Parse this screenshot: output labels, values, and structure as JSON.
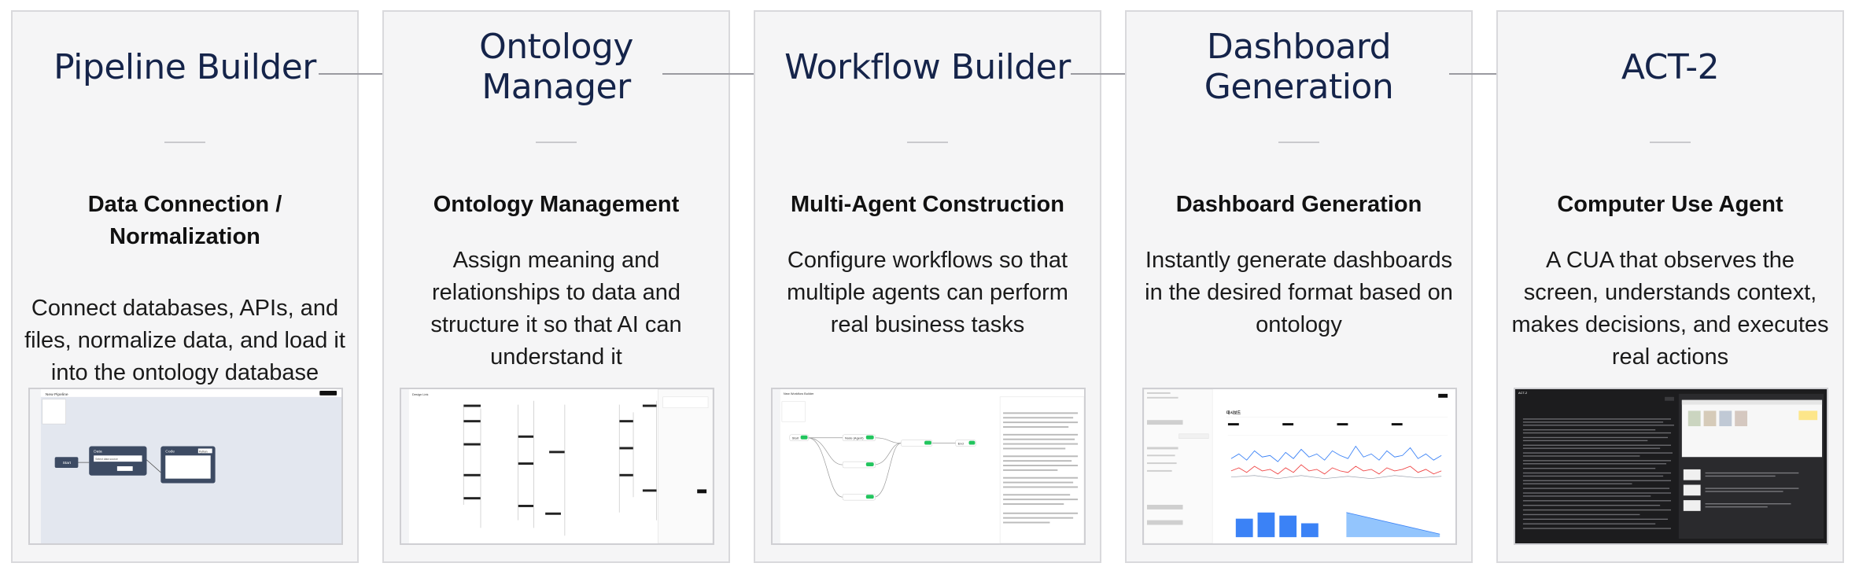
{
  "stages": [
    {
      "title": "Pipeline Builder",
      "heading": "Data Connection / Normalization",
      "description": "Connect databases, APIs, and files, normalize data, and load it into the ontology database",
      "preview": {
        "title": "New Pipeline",
        "node_start": "Start",
        "node_data": "Data",
        "node_code": "Code",
        "node_data_field": "Select data source",
        "node_code_lang": "Python"
      }
    },
    {
      "title": "Ontology Manager",
      "heading": "Ontology Management",
      "description": "Assign meaning and relationships to data and structure it so that AI can understand it",
      "preview": {
        "title": "Design Link"
      }
    },
    {
      "title": "Workflow Builder",
      "heading": "Multi-Agent Construction",
      "description": "Configure workflows so that multiple agents can perform real business tasks",
      "preview": {
        "title": "New Workflow Builder",
        "node_start": "Start",
        "node_agent": "Node (Agent)",
        "node_end": "End"
      }
    },
    {
      "title": "Dashboard Generation",
      "heading": "Dashboard Generation",
      "description": "Instantly generate dashboards in the desired format based on ontology",
      "preview": {
        "title": "대시보드"
      }
    },
    {
      "title": "ACT-2",
      "heading": "Computer Use Agent",
      "description": "A CUA that observes the screen, understands context, makes decisions, and executes real actions",
      "preview": {
        "title": "ACT-2"
      }
    }
  ],
  "colors": {
    "title": "#15244a",
    "panel_bg": "#f5f5f6",
    "border": "#d9d9dc",
    "accent_green": "#22c55e",
    "chart_blue": "#3b82f6"
  }
}
